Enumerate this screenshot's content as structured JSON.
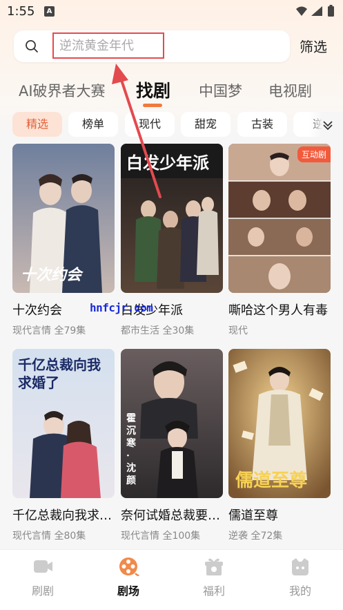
{
  "status_bar": {
    "time": "1:55",
    "notif_glyph": "A"
  },
  "search": {
    "placeholder": "逆流黄金年代"
  },
  "filter_label": "筛选",
  "tabs": [
    {
      "label": "AI破界者大赛",
      "active": false
    },
    {
      "label": "找剧",
      "active": true
    },
    {
      "label": "中国梦",
      "active": false
    },
    {
      "label": "电视剧",
      "active": false
    }
  ],
  "chips": [
    {
      "label": "精选",
      "active": true
    },
    {
      "label": "榜单",
      "active": false
    },
    {
      "label": "现代",
      "active": false
    },
    {
      "label": "甜宠",
      "active": false
    },
    {
      "label": "古装",
      "active": false
    },
    {
      "label": "逆",
      "active": false
    }
  ],
  "dramas": [
    {
      "title": "十次约会",
      "meta": "现代言情 全79集",
      "badge": "",
      "poster_text": "十次约会",
      "colors": [
        "#5a6b8c",
        "#c8b7b0"
      ]
    },
    {
      "title": "白发少年派",
      "meta": "都市生活 全30集",
      "badge": "",
      "poster_text": "白发少年派",
      "colors": [
        "#2d2a2a",
        "#8a5a4a"
      ]
    },
    {
      "title": "嘶哈这个男人有毒",
      "meta": "现代",
      "badge": "互动剧",
      "poster_text": "",
      "colors": [
        "#b89a85",
        "#6d4e40"
      ]
    },
    {
      "title": "千亿总裁向我求婚了",
      "meta": "现代言情 全80集",
      "badge": "",
      "poster_text": "千亿总裁向我求婚了",
      "colors": [
        "#c9d6e8",
        "#e8e3ea"
      ]
    },
    {
      "title": "奈何试婚总裁要娶我",
      "meta": "现代言情 全100集",
      "badge": "",
      "poster_text": "霍沉寒 · 沈颜",
      "colors": [
        "#3d3a3e",
        "#9a8886"
      ]
    },
    {
      "title": "儒道至尊",
      "meta": "逆袭 全72集",
      "badge": "",
      "poster_text": "儒道至尊",
      "colors": [
        "#c89a55",
        "#6b4a2a"
      ]
    }
  ],
  "watermark": "hnfcjr.com",
  "bottom_nav": [
    {
      "label": "刷剧",
      "icon": "video-icon",
      "active": false
    },
    {
      "label": "剧场",
      "icon": "film-reel-icon",
      "active": true
    },
    {
      "label": "福利",
      "icon": "gift-icon",
      "active": false
    },
    {
      "label": "我的",
      "icon": "profile-icon",
      "active": false
    }
  ],
  "accent_color": "#f07a3c"
}
